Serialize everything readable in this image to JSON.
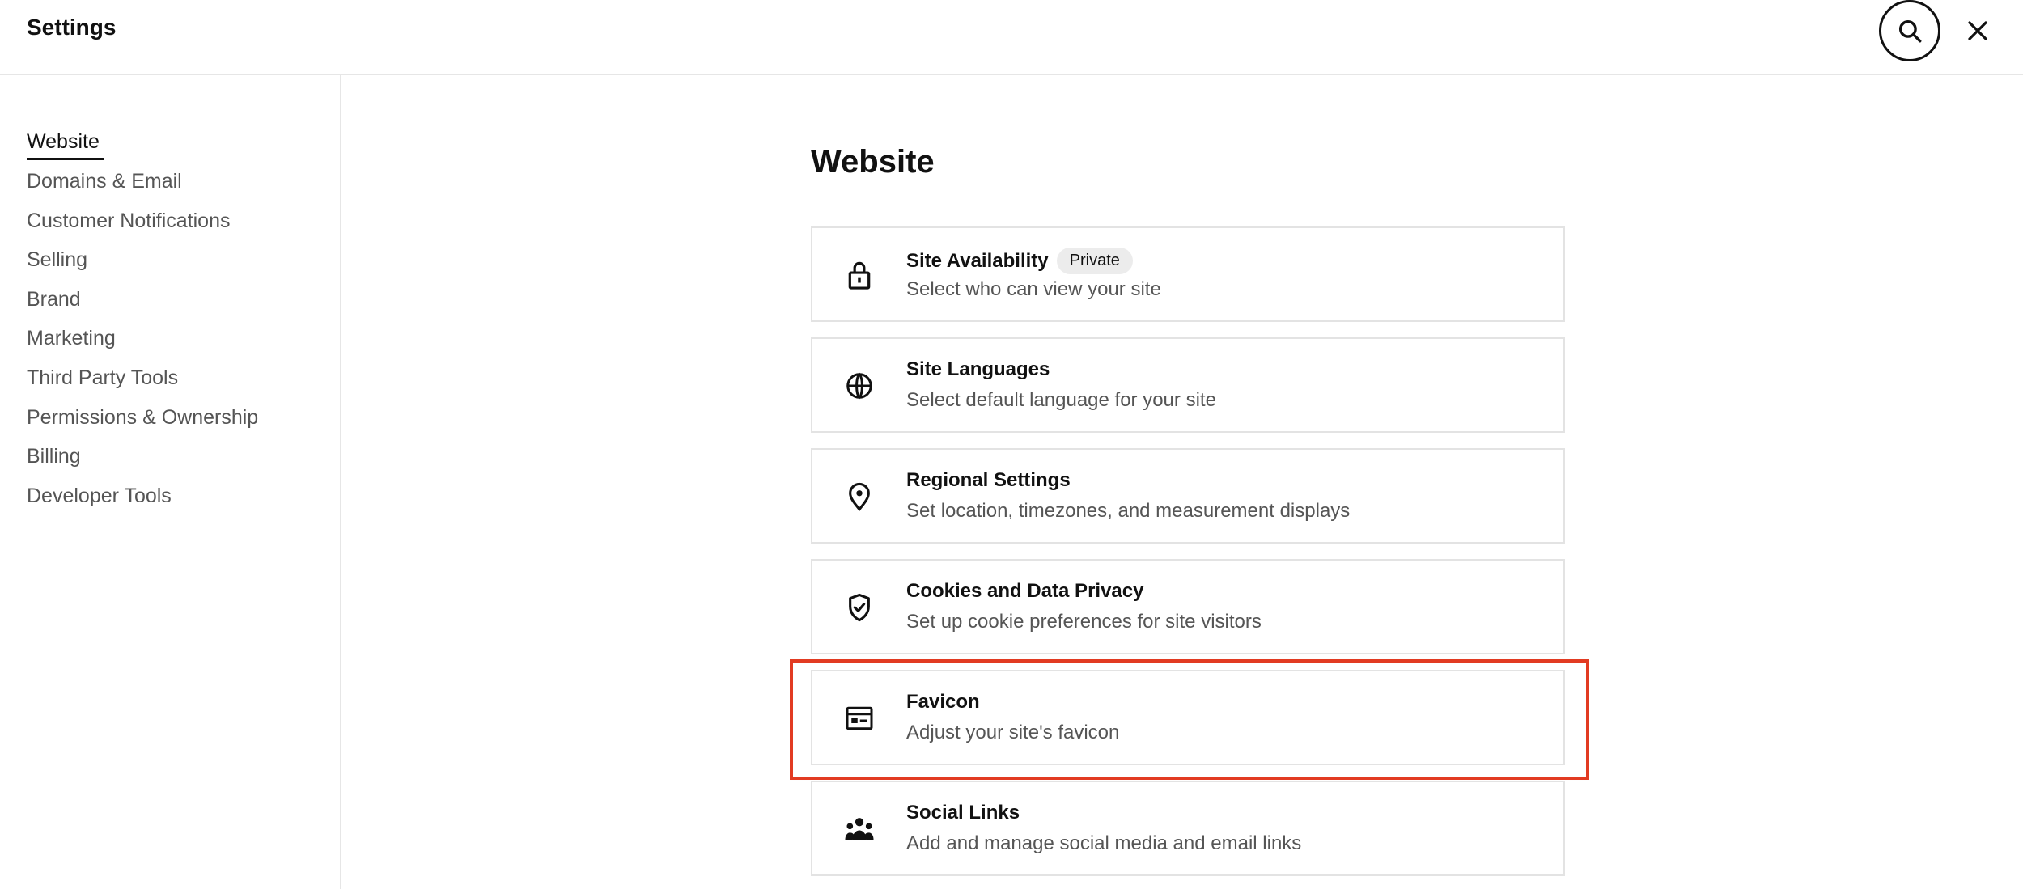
{
  "app": {
    "title": "Settings"
  },
  "sidebar": {
    "items": [
      {
        "label": "Website"
      },
      {
        "label": "Domains & Email"
      },
      {
        "label": "Customer Notifications"
      },
      {
        "label": "Selling"
      },
      {
        "label": "Brand"
      },
      {
        "label": "Marketing"
      },
      {
        "label": "Third Party Tools"
      },
      {
        "label": "Permissions & Ownership"
      },
      {
        "label": "Billing"
      },
      {
        "label": "Developer Tools"
      }
    ],
    "active": "Website"
  },
  "main": {
    "title": "Website",
    "cards": [
      {
        "title": "Site Availability",
        "badge": "Private",
        "desc": "Select who can view your site",
        "icon": "lock-icon"
      },
      {
        "title": "Site Languages",
        "desc": "Select default language for your site",
        "icon": "globe-icon"
      },
      {
        "title": "Regional Settings",
        "desc": "Set location, timezones, and measurement displays",
        "icon": "location-pin-icon"
      },
      {
        "title": "Cookies and Data Privacy",
        "desc": "Set up cookie preferences for site visitors",
        "icon": "shield-check-icon"
      },
      {
        "title": "Favicon",
        "desc": "Adjust your site's favicon",
        "icon": "browser-window-icon"
      },
      {
        "title": "Social Links",
        "desc": "Add and manage social media and email links",
        "icon": "people-icon"
      }
    ]
  },
  "colors": {
    "highlight": "#e23b22",
    "text": "#111111",
    "muted": "#555555",
    "border": "#e3e3e3"
  }
}
